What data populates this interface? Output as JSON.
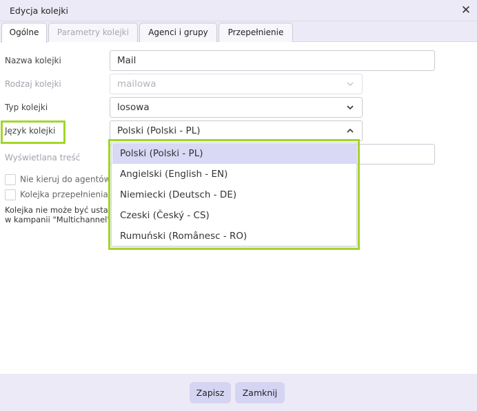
{
  "window": {
    "title": "Edycja kolejki"
  },
  "tabs": [
    {
      "label": "Ogólne"
    },
    {
      "label": "Parametry kolejki"
    },
    {
      "label": "Agenci i grupy"
    },
    {
      "label": "Przepełnienie"
    }
  ],
  "form": {
    "queue_name": {
      "label": "Nazwa kolejki",
      "value": "Mail"
    },
    "queue_kind": {
      "label": "Rodzaj kolejki",
      "value": "mailowa"
    },
    "queue_type": {
      "label": "Typ kolejki",
      "value": "losowa"
    },
    "queue_lang": {
      "label": "Język kolejki",
      "value": "Polski (Polski - PL)"
    },
    "displayed_content": {
      "label": "Wyświetlana treść",
      "value": ""
    },
    "checkbox_1": {
      "label": "Nie kieruj do agentów"
    },
    "checkbox_2": {
      "label": "Kolejka przepełnienia"
    },
    "note_line1": "Kolejka nie może być ustawiona",
    "note_line2": "w kampanii \"Multichannel\""
  },
  "dropdown": {
    "options": [
      "Polski (Polski - PL)",
      "Angielski (English - EN)",
      "Niemiecki (Deutsch - DE)",
      "Czeski (Český - CS)",
      "Rumuński (Românesc - RO)"
    ],
    "selected_index": 0
  },
  "footer": {
    "save_label": "Zapisz",
    "close_label": "Zamknij"
  },
  "colors": {
    "highlight": "#a4d52a",
    "selected_option": "#d9d8f5",
    "button": "#d6d4f3"
  }
}
